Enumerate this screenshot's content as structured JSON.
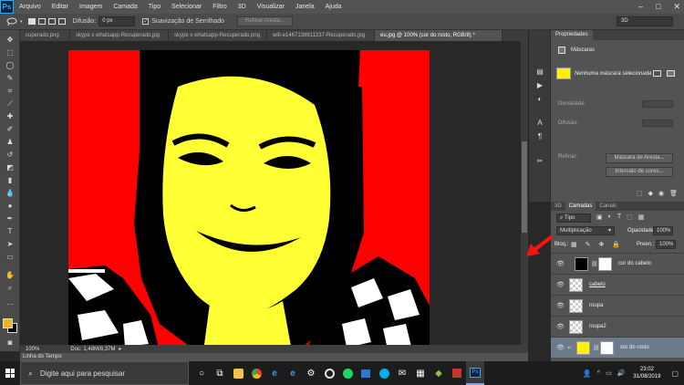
{
  "app": {
    "logo": "Ps"
  },
  "menu": [
    "Arquivo",
    "Editar",
    "Imagem",
    "Camada",
    "Tipo",
    "Selecionar",
    "Filtro",
    "3D",
    "Visualizar",
    "Janela",
    "Ajuda"
  ],
  "window_controls": [
    "–",
    "□",
    "✕"
  ],
  "options_bar": {
    "feather_label": "Difusão:",
    "feather_value": "0 px",
    "antialias_label": "Suavização de Serrilhado",
    "refine_edge_label": "Refinar Aresta...",
    "workspace": "3D"
  },
  "tabs": [
    {
      "label": "cuperado.png"
    },
    {
      "label": "skype x whatsapp-Recuperado.jpg"
    },
    {
      "label": "skype x whatsapp-Recuperado.png"
    },
    {
      "label": "wifi-e1467138811237-Recuperado.jpg"
    },
    {
      "label": "eu.jpg @ 100% (cor do rosto, RGB/8) *"
    }
  ],
  "status": {
    "zoom": "100%",
    "doc": "Doc: 1,48M/8,37M"
  },
  "timeline_label": "Linha do Tempo",
  "properties": {
    "title": "Propriedades",
    "mask_header": "Máscaras",
    "mask_status": "Nenhuma máscara selecionada",
    "density_label": "Densidade:",
    "feather_label": "Difusão:",
    "refine_label": "Refinar:",
    "mask_edge_button": "Máscara de Aresta...",
    "color_range_button": "Intervalo de cores..."
  },
  "layers": {
    "tabs": [
      "3D",
      "Camadas",
      "Canais"
    ],
    "filter_kind": "Tipo",
    "blend_mode": "Multiplicação",
    "opacity_label": "Opacidade:",
    "opacity_value": "100%",
    "lock_label": "Bloq.:",
    "fill_label": "Preen.:",
    "fill_value": "100%",
    "items": [
      {
        "name": "cor do cabelo"
      },
      {
        "name": "cabelo"
      },
      {
        "name": "roupa"
      },
      {
        "name": "roupa2"
      },
      {
        "name": "cor do rosto"
      }
    ]
  },
  "taskbar": {
    "search_placeholder": "Digite aqui para pesquisar",
    "time": "23:02",
    "date": "31/08/2019"
  }
}
